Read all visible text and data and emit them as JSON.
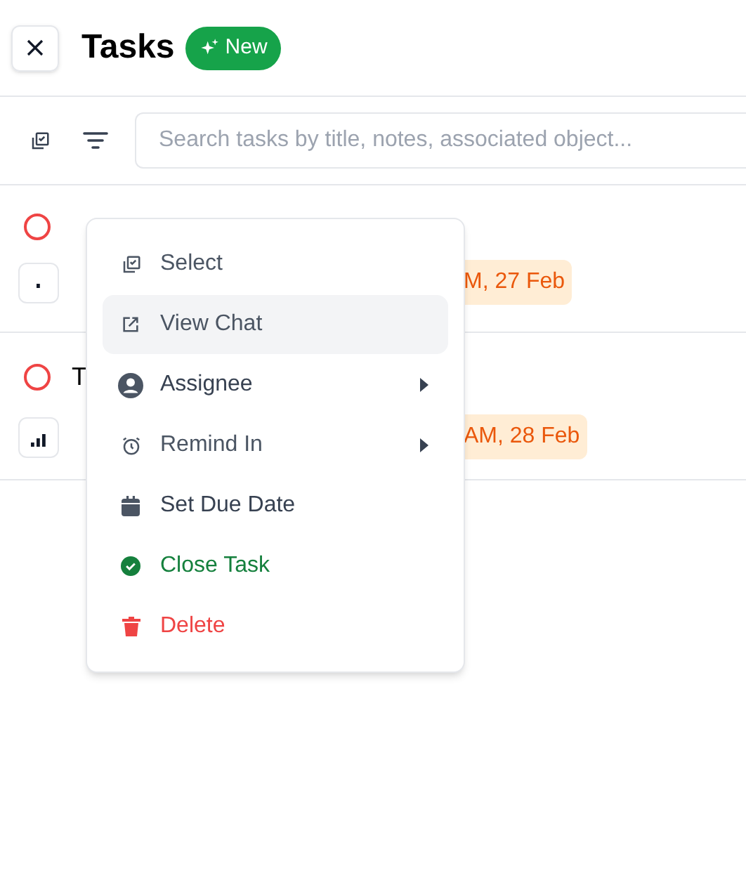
{
  "header": {
    "title": "Tasks",
    "badge": "New"
  },
  "search": {
    "placeholder": "Search tasks by title, notes, associated object..."
  },
  "tasks": [
    {
      "kind": "low",
      "due": "M, 27 Feb"
    },
    {
      "title": "T",
      "kind": "high",
      "due": "AM, 28 Feb"
    }
  ],
  "menu": [
    {
      "label": "Select",
      "kind": "select",
      "selected": false,
      "submenu": false
    },
    {
      "label": "View Chat",
      "kind": "chat",
      "selected": true,
      "submenu": false
    },
    {
      "label": "Assignee",
      "kind": "assignee",
      "selected": false,
      "submenu": true
    },
    {
      "label": "Remind In",
      "kind": "remind",
      "selected": false,
      "submenu": true
    },
    {
      "label": "Set Due Date",
      "kind": "due",
      "selected": false,
      "submenu": false
    },
    {
      "label": "Close Task",
      "kind": "close",
      "selected": false,
      "submenu": false
    },
    {
      "label": "Delete",
      "kind": "delete",
      "selected": false,
      "submenu": false
    }
  ]
}
